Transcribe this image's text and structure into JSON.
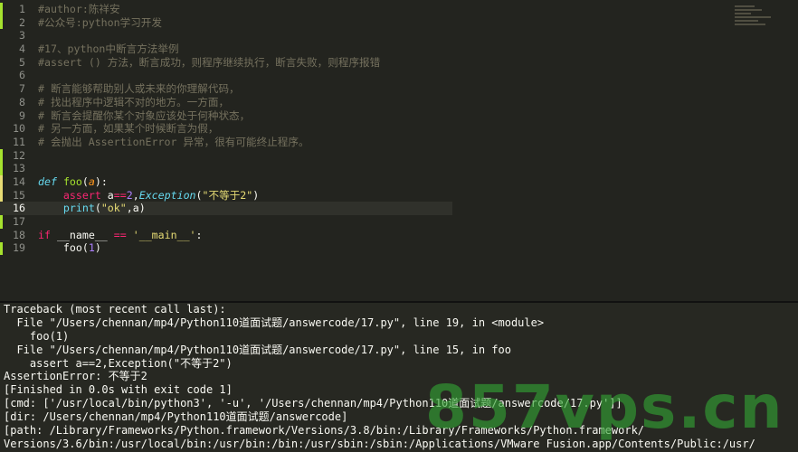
{
  "editor": {
    "gutter_colors": {
      "added": "#a6e22e",
      "modified": "#e6db74"
    },
    "lines": [
      {
        "num": "1",
        "tokens": [
          {
            "t": "#author:陈祥安",
            "c": "comment"
          }
        ]
      },
      {
        "num": "2",
        "tokens": [
          {
            "t": "#公众号:python学习开发",
            "c": "comment"
          }
        ]
      },
      {
        "num": "3",
        "tokens": []
      },
      {
        "num": "4",
        "tokens": [
          {
            "t": "#17、python中断言方法举例",
            "c": "comment"
          }
        ]
      },
      {
        "num": "5",
        "tokens": [
          {
            "t": "#assert () 方法，断言成功，则程序继续执行，断言失败，则程序报错",
            "c": "comment"
          }
        ]
      },
      {
        "num": "6",
        "tokens": []
      },
      {
        "num": "7",
        "tokens": [
          {
            "t": "# 断言能够帮助别人或未来的你理解代码，",
            "c": "comment"
          }
        ]
      },
      {
        "num": "8",
        "tokens": [
          {
            "t": "# 找出程序中逻辑不对的地方。一方面，",
            "c": "comment"
          }
        ]
      },
      {
        "num": "9",
        "tokens": [
          {
            "t": "# 断言会提醒你某个对象应该处于何种状态，",
            "c": "comment"
          }
        ]
      },
      {
        "num": "10",
        "tokens": [
          {
            "t": "# 另一方面，如果某个时候断言为假，",
            "c": "comment"
          }
        ]
      },
      {
        "num": "11",
        "tokens": [
          {
            "t": "# 会抛出 AssertionError 异常，很有可能终止程序。",
            "c": "comment"
          }
        ]
      },
      {
        "num": "12",
        "tokens": []
      },
      {
        "num": "13",
        "tokens": []
      },
      {
        "num": "14",
        "tokens": [
          {
            "t": "def",
            "c": "kw"
          },
          {
            "t": " ",
            "c": "plain"
          },
          {
            "t": "foo",
            "c": "fn"
          },
          {
            "t": "(",
            "c": "plain"
          },
          {
            "t": "a",
            "c": "param"
          },
          {
            "t": "):",
            "c": "plain"
          }
        ]
      },
      {
        "num": "15",
        "tokens": [
          {
            "t": "    ",
            "c": "plain"
          },
          {
            "t": "assert",
            "c": "kw2"
          },
          {
            "t": " a",
            "c": "plain"
          },
          {
            "t": "==",
            "c": "op"
          },
          {
            "t": "2",
            "c": "num"
          },
          {
            "t": ",",
            "c": "plain"
          },
          {
            "t": "Exception",
            "c": "cls"
          },
          {
            "t": "(",
            "c": "plain"
          },
          {
            "t": "\"不等于2\"",
            "c": "str"
          },
          {
            "t": ")",
            "c": "plain"
          }
        ]
      },
      {
        "num": "16",
        "tokens": [
          {
            "t": "    ",
            "c": "plain"
          },
          {
            "t": "print",
            "c": "builtin"
          },
          {
            "t": "(",
            "c": "plain"
          },
          {
            "t": "\"ok\"",
            "c": "str"
          },
          {
            "t": ",a)",
            "c": "plain"
          }
        ]
      },
      {
        "num": "17",
        "tokens": []
      },
      {
        "num": "18",
        "tokens": [
          {
            "t": "if",
            "c": "kw2"
          },
          {
            "t": " __name__ ",
            "c": "plain"
          },
          {
            "t": "==",
            "c": "op"
          },
          {
            "t": " ",
            "c": "plain"
          },
          {
            "t": "'__main__'",
            "c": "str"
          },
          {
            "t": ":",
            "c": "plain"
          }
        ]
      },
      {
        "num": "19",
        "tokens": [
          {
            "t": "    foo(",
            "c": "plain"
          },
          {
            "t": "1",
            "c": "num"
          },
          {
            "t": ")",
            "c": "plain"
          }
        ]
      }
    ],
    "active_line": "16"
  },
  "console": {
    "lines": [
      "Traceback (most recent call last):",
      "  File \"/Users/chennan/mp4/Python110道面试题/answercode/17.py\", line 19, in <module>",
      "    foo(1)",
      "  File \"/Users/chennan/mp4/Python110道面试题/answercode/17.py\", line 15, in foo",
      "    assert a==2,Exception(\"不等于2\")",
      "AssertionError: 不等于2",
      "[Finished in 0.0s with exit code 1]",
      "[cmd: ['/usr/local/bin/python3', '-u', '/Users/chennan/mp4/Python110道面试题/answercode/17.py']]",
      "[dir: /Users/chennan/mp4/Python110道面试题/answercode]",
      "[path: /Library/Frameworks/Python.framework/Versions/3.8/bin:/Library/Frameworks/Python.framework/",
      "Versions/3.6/bin:/usr/local/bin:/usr/bin:/bin:/usr/sbin:/sbin:/Applications/VMware Fusion.app/Contents/Public:/usr/"
    ]
  },
  "watermark": {
    "text": "857vps.cn",
    "color": "#34a534"
  }
}
